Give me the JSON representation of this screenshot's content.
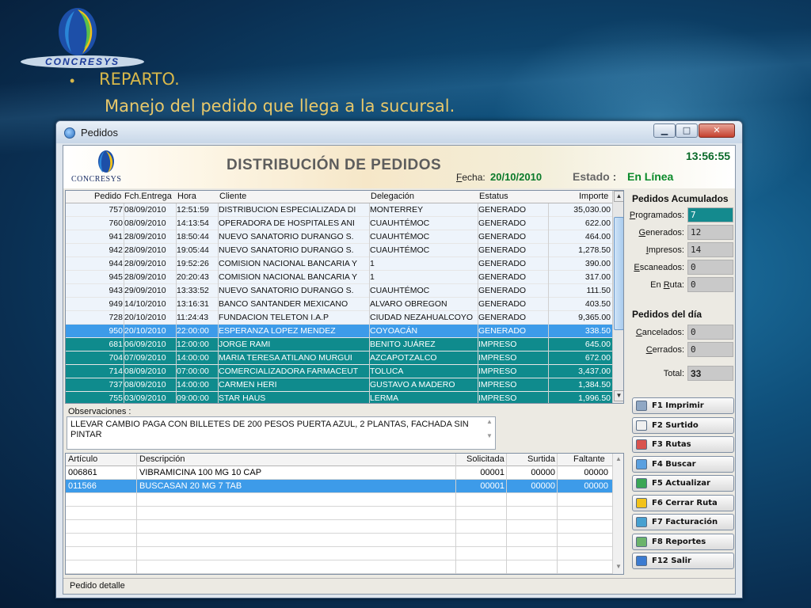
{
  "slide": {
    "logo_text": "CONCRESYS",
    "bullet": "•",
    "title": "REPARTO.",
    "subtitle": "Manejo del pedido que llega a la sucursal."
  },
  "window": {
    "title": "Pedidos",
    "min_icon": "minimize-icon",
    "max_icon": "maximize-icon",
    "close_icon": "close-icon"
  },
  "header": {
    "logo_text": "CONCRESYS",
    "title": "DISTRIBUCIÓN DE PEDIDOS",
    "fecha_label_u": "F",
    "fecha_label_rest": "echa:",
    "fecha": "20/10/2010",
    "estado_label": "Estado :",
    "estado": "En Línea",
    "time": "13:56:55"
  },
  "orders": {
    "columns": [
      "Pedido",
      "Fch.Entrega",
      "Hora",
      "Cliente",
      "Delegación",
      "Estatus",
      "Importe"
    ],
    "rows": [
      {
        "pedido": "757",
        "fecha": "08/09/2010",
        "hora": "12:51:59",
        "cliente": "DISTRIBUCION ESPECIALIZADA DI",
        "delegacion": "MONTERREY",
        "estatus": "GENERADO",
        "importe": "35,030.00",
        "state": "gen"
      },
      {
        "pedido": "760",
        "fecha": "08/09/2010",
        "hora": "14:13:54",
        "cliente": "OPERADORA DE HOSPITALES ANI",
        "delegacion": "CUAUHTÉMOC",
        "estatus": "GENERADO",
        "importe": "622.00",
        "state": "gen"
      },
      {
        "pedido": "941",
        "fecha": "28/09/2010",
        "hora": "18:50:44",
        "cliente": "NUEVO SANATORIO DURANGO S.",
        "delegacion": "CUAUHTÉMOC",
        "estatus": "GENERADO",
        "importe": "464.00",
        "state": "gen"
      },
      {
        "pedido": "942",
        "fecha": "28/09/2010",
        "hora": "19:05:44",
        "cliente": "NUEVO SANATORIO DURANGO S.",
        "delegacion": "CUAUHTÉMOC",
        "estatus": "GENERADO",
        "importe": "1,278.50",
        "state": "gen"
      },
      {
        "pedido": "944",
        "fecha": "28/09/2010",
        "hora": "19:52:26",
        "cliente": "COMISION NACIONAL BANCARIA Y",
        "delegacion": "1",
        "estatus": "GENERADO",
        "importe": "390.00",
        "state": "gen"
      },
      {
        "pedido": "945",
        "fecha": "28/09/2010",
        "hora": "20:20:43",
        "cliente": "COMISION NACIONAL BANCARIA Y",
        "delegacion": "1",
        "estatus": "GENERADO",
        "importe": "317.00",
        "state": "gen"
      },
      {
        "pedido": "943",
        "fecha": "29/09/2010",
        "hora": "13:33:52",
        "cliente": "NUEVO SANATORIO DURANGO S.",
        "delegacion": "CUAUHTÉMOC",
        "estatus": "GENERADO",
        "importe": "111.50",
        "state": "gen"
      },
      {
        "pedido": "949",
        "fecha": "14/10/2010",
        "hora": "13:16:31",
        "cliente": "BANCO SANTANDER MEXICANO",
        "delegacion": "ALVARO OBREGON",
        "estatus": "GENERADO",
        "importe": "403.50",
        "state": "gen"
      },
      {
        "pedido": "728",
        "fecha": "20/10/2010",
        "hora": "11:24:43",
        "cliente": "FUNDACION TELETON I.A.P",
        "delegacion": "CIUDAD NEZAHUALCOYO",
        "estatus": "GENERADO",
        "importe": "9,365.00",
        "state": "gen"
      },
      {
        "pedido": "950",
        "fecha": "20/10/2010",
        "hora": "22:00:00",
        "cliente": "ESPERANZA LOPEZ MENDEZ",
        "delegacion": "COYOACÁN",
        "estatus": "GENERADO",
        "importe": "338.50",
        "state": "sel"
      },
      {
        "pedido": "681",
        "fecha": "06/09/2010",
        "hora": "12:00:00",
        "cliente": "JORGE                    RAMI",
        "delegacion": "BENITO JUÁREZ",
        "estatus": "IMPRESO",
        "importe": "645.00",
        "state": "imp"
      },
      {
        "pedido": "704",
        "fecha": "07/09/2010",
        "hora": "14:00:00",
        "cliente": "MARIA TERESA ATILANO MURGUI",
        "delegacion": "AZCAPOTZALCO",
        "estatus": "IMPRESO",
        "importe": "672.00",
        "state": "imp"
      },
      {
        "pedido": "714",
        "fecha": "08/09/2010",
        "hora": "07:00:00",
        "cliente": "COMERCIALIZADORA FARMACEUT",
        "delegacion": "TOLUCA",
        "estatus": "IMPRESO",
        "importe": "3,437.00",
        "state": "imp"
      },
      {
        "pedido": "737",
        "fecha": "08/09/2010",
        "hora": "14:00:00",
        "cliente": "CARMEN                   HERI",
        "delegacion": "GUSTAVO A MADERO",
        "estatus": "IMPRESO",
        "importe": "1,384.50",
        "state": "imp"
      },
      {
        "pedido": "755",
        "fecha": "03/09/2010",
        "hora": "09:00:00",
        "cliente": "STAR HAUS",
        "delegacion": "LERMA",
        "estatus": "IMPRESO",
        "importe": "1,996.50",
        "state": "imp"
      }
    ]
  },
  "observaciones": {
    "label": "Observaciones :",
    "text": "LLEVAR CAMBIO PAGA CON BILLETES DE 200 PESOS     PUERTA AZUL, 2 PLANTAS, FACHADA SIN PINTAR"
  },
  "items": {
    "columns": [
      "Artículo",
      "Descripción",
      "Solicitada",
      "Surtida",
      "Faltante"
    ],
    "rows": [
      {
        "articulo": "006861",
        "descripcion": "VIBRAMICINA 100 MG 10 CAP",
        "solicitada": "00001",
        "surtida": "00000",
        "faltante": "00000",
        "state": "normal"
      },
      {
        "articulo": "011566",
        "descripcion": "BUSCASAN 20 MG 7 TAB",
        "solicitada": "00001",
        "surtida": "00000",
        "faltante": "00000",
        "state": "sel"
      }
    ]
  },
  "status_bar": "Pedido detalle",
  "acumulados": {
    "title": "Pedidos Acumulados",
    "programados": {
      "label_u": "P",
      "label_rest": "rogramados:",
      "value": "7"
    },
    "generados": {
      "label_u": "G",
      "label_rest": "enerados:",
      "value": "12"
    },
    "impresos": {
      "label_u": "I",
      "label_rest": "mpresos:",
      "value": "14"
    },
    "escaneados": {
      "label_u": "E",
      "label_rest": "scaneados:",
      "value": "0"
    },
    "en_ruta": {
      "label_pre": "En ",
      "label_u": "R",
      "label_rest": "uta:",
      "value": "0"
    }
  },
  "dia": {
    "title": "Pedidos del día",
    "cancelados": {
      "label_u": "C",
      "label_rest": "ancelados:",
      "value": "0"
    },
    "cerrados": {
      "label_u": "C",
      "label_rest": "errados:",
      "value": "0"
    },
    "total": {
      "label": "Total:",
      "value": "33"
    }
  },
  "function_buttons": [
    {
      "label": "F1   Imprimir",
      "icon": "printer-icon"
    },
    {
      "label": "F2   Surtido",
      "icon": "document-icon"
    },
    {
      "label": "F3   Rutas",
      "icon": "list-icon"
    },
    {
      "label": "F4   Buscar",
      "icon": "search-icon"
    },
    {
      "label": "F5   Actualizar",
      "icon": "refresh-icon"
    },
    {
      "label": "F6   Cerrar Ruta",
      "icon": "folder-icon"
    },
    {
      "label": "F7   Facturación",
      "icon": "invoice-icon"
    },
    {
      "label": "F8   Reportes",
      "icon": "report-icon"
    },
    {
      "label": "F12  Salir",
      "icon": "exit-icon"
    }
  ],
  "colors": {
    "selected_row": "#3d9be9",
    "impreso_row": "#0f8b8d",
    "accent_green": "#0a8a2a",
    "slide_title": "#d8b84a"
  }
}
